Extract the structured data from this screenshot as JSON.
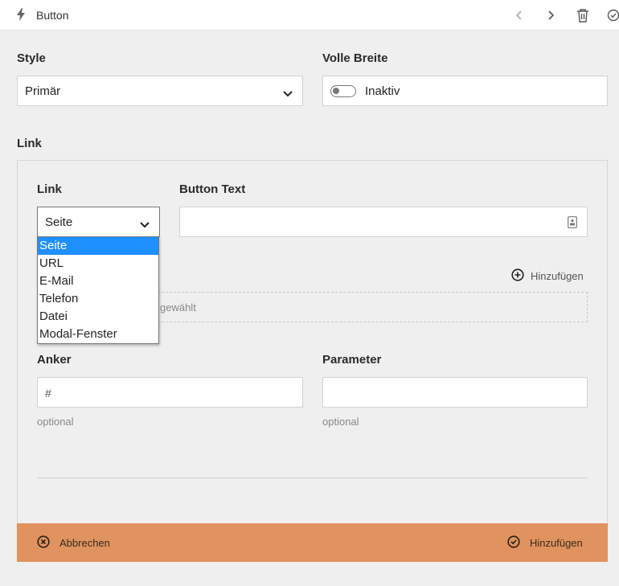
{
  "header": {
    "title": "Button",
    "title_icon": "lightning-icon",
    "actions": [
      "chevron-left-icon",
      "chevron-right-icon",
      "trash-icon",
      "check-circle-icon"
    ]
  },
  "style_field": {
    "label": "Style",
    "value": "Primär"
  },
  "full_width_field": {
    "label": "Volle Breite",
    "toggle_label": "Inaktiv",
    "enabled": false
  },
  "link_section": {
    "title": "Link",
    "link_label": "Link",
    "link_value": "Seite",
    "options": [
      "Seite",
      "URL",
      "E-Mail",
      "Telefon",
      "Datei",
      "Modal-Fenster"
    ],
    "selected_option": "Seite",
    "button_text_label": "Button Text",
    "button_text_value": "",
    "add_label": "Hinzufügen",
    "empty_text_visible": "gewählt",
    "anchor_label": "Anker",
    "anchor_placeholder": "#",
    "anchor_hint": "optional",
    "parameter_label": "Parameter",
    "parameter_hint": "optional"
  },
  "footer": {
    "cancel_label": "Abbrechen",
    "confirm_label": "Hinzufügen",
    "background": "#e0935e"
  },
  "colors": {
    "selection": "#1e90ff"
  }
}
